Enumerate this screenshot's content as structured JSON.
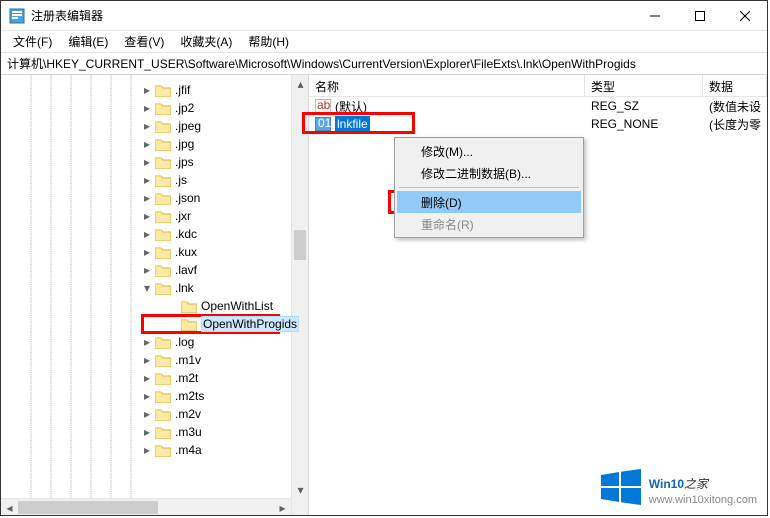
{
  "window": {
    "title": "注册表编辑器"
  },
  "menu": {
    "file": "文件(F)",
    "edit": "编辑(E)",
    "view": "查看(V)",
    "favorites": "收藏夹(A)",
    "help": "帮助(H)"
  },
  "address": "计算机\\HKEY_CURRENT_USER\\Software\\Microsoft\\Windows\\CurrentVersion\\Explorer\\FileExts\\.lnk\\OpenWithProgids",
  "tree": {
    "items": [
      {
        "label": ".jfif",
        "depth": 0,
        "exp": false
      },
      {
        "label": ".jp2",
        "depth": 0,
        "exp": false
      },
      {
        "label": ".jpeg",
        "depth": 0,
        "exp": false
      },
      {
        "label": ".jpg",
        "depth": 0,
        "exp": false
      },
      {
        "label": ".jps",
        "depth": 0,
        "exp": false
      },
      {
        "label": ".js",
        "depth": 0,
        "exp": false
      },
      {
        "label": ".json",
        "depth": 0,
        "exp": false
      },
      {
        "label": ".jxr",
        "depth": 0,
        "exp": false
      },
      {
        "label": ".kdc",
        "depth": 0,
        "exp": false
      },
      {
        "label": ".kux",
        "depth": 0,
        "exp": false
      },
      {
        "label": ".lavf",
        "depth": 0,
        "exp": false
      },
      {
        "label": ".lnk",
        "depth": 0,
        "exp": true
      },
      {
        "label": "OpenWithList",
        "depth": 1,
        "exp": null
      },
      {
        "label": "OpenWithProgids",
        "depth": 1,
        "exp": null,
        "selected": true
      },
      {
        "label": ".log",
        "depth": 0,
        "exp": false
      },
      {
        "label": ".m1v",
        "depth": 0,
        "exp": false
      },
      {
        "label": ".m2t",
        "depth": 0,
        "exp": false
      },
      {
        "label": ".m2ts",
        "depth": 0,
        "exp": false
      },
      {
        "label": ".m2v",
        "depth": 0,
        "exp": false
      },
      {
        "label": ".m3u",
        "depth": 0,
        "exp": false
      },
      {
        "label": ".m4a",
        "depth": 0,
        "exp": false
      }
    ]
  },
  "list": {
    "col_name": "名称",
    "col_type": "类型",
    "col_data": "数据",
    "rows": [
      {
        "name": "(默认)",
        "type": "REG_SZ",
        "data": "(数值未设",
        "kind": "sz",
        "selected": false
      },
      {
        "name": "lnkfile",
        "type": "REG_NONE",
        "data": "(长度为零",
        "kind": "bin",
        "selected": true
      }
    ]
  },
  "context_menu": {
    "modify": "修改(M)...",
    "modify_binary": "修改二进制数据(B)...",
    "delete": "删除(D)",
    "rename": "重命名(R)"
  },
  "watermark": {
    "brand_a": "Win10",
    "brand_b": "之家",
    "url": "www.win10xitong.com"
  }
}
